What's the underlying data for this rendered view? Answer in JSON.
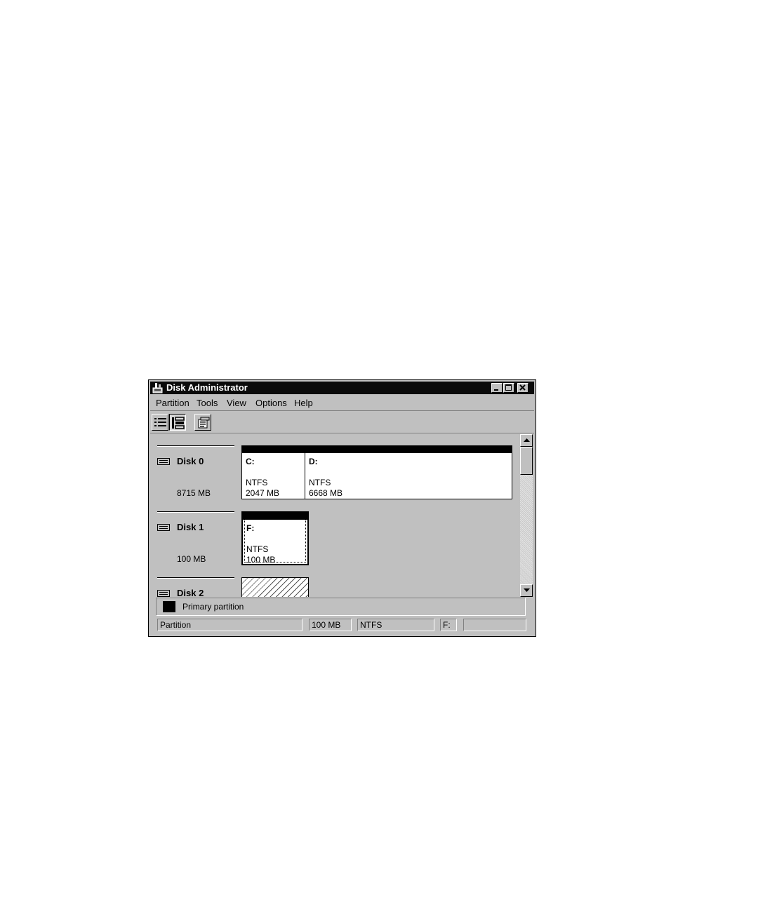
{
  "window": {
    "title": "Disk Administrator"
  },
  "menu": [
    "Partition",
    "Tools",
    "View",
    "Options",
    "Help"
  ],
  "toolbar": {
    "icons": [
      "volumes-view-icon",
      "disk-configuration-view-icon",
      "properties-icon"
    ]
  },
  "disks": [
    {
      "name": "Disk 0",
      "size": "8715 MB",
      "partitions": [
        {
          "letter": "C:",
          "fs": "NTFS",
          "size": "2047 MB"
        },
        {
          "letter": "D:",
          "fs": "NTFS",
          "size": "6668 MB"
        }
      ]
    },
    {
      "name": "Disk 1",
      "size": "100 MB",
      "partitions": [
        {
          "letter": "F:",
          "fs": "NTFS",
          "size": "100 MB",
          "selected": true
        }
      ]
    },
    {
      "name": "Disk 2",
      "size": "",
      "partitions": []
    }
  ],
  "legend": {
    "label": "Primary partition",
    "color": "#000000"
  },
  "statusbar": {
    "type": "Partition",
    "size": "100 MB",
    "fs": "NTFS",
    "letter": "F:",
    "extra": ""
  }
}
